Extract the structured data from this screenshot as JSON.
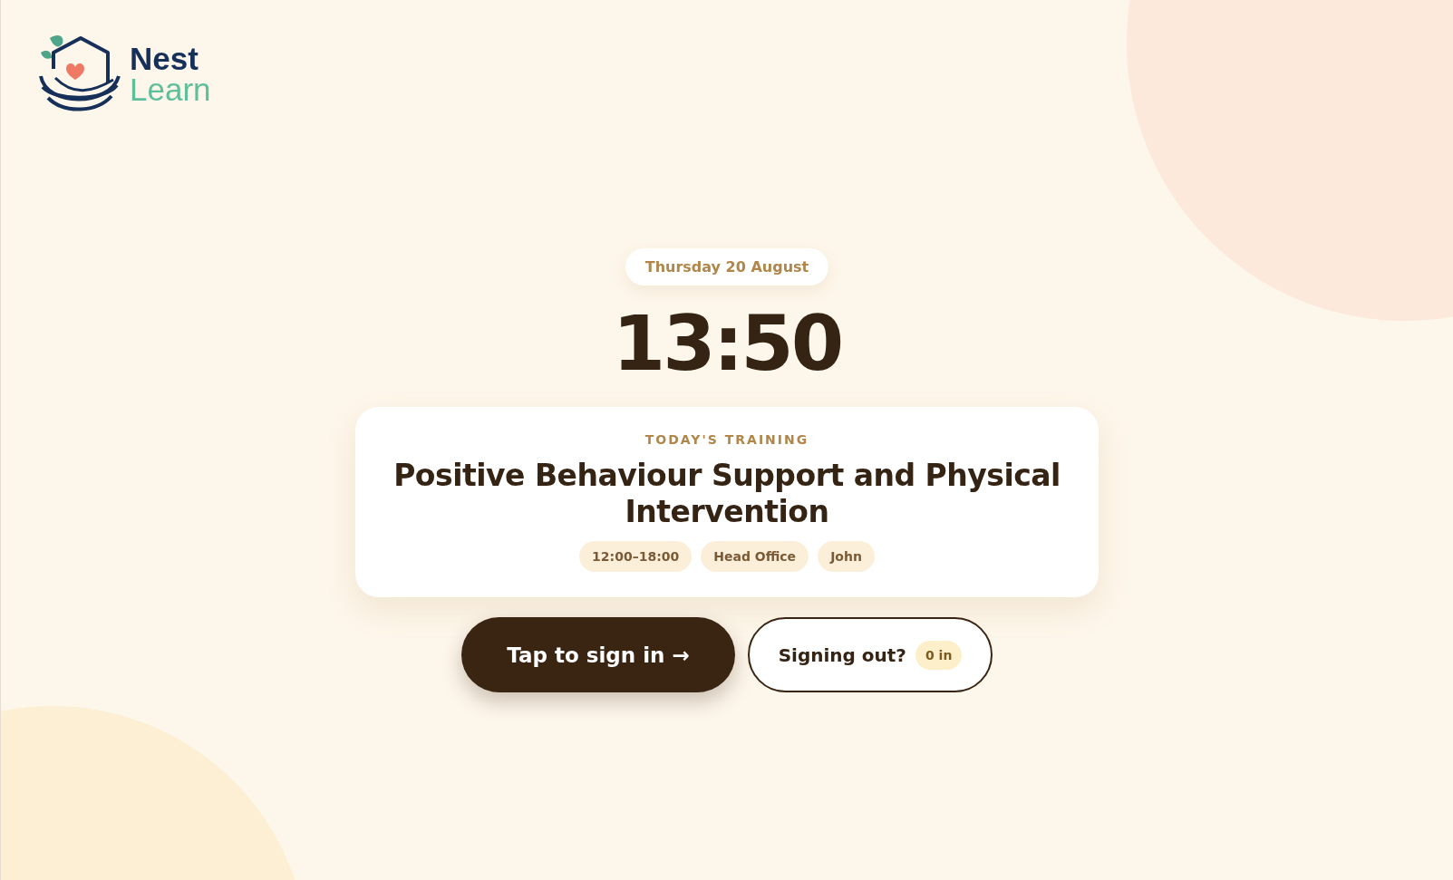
{
  "logo": {
    "line_1": "Nest",
    "line_2": "Learn"
  },
  "date": "Thursday 20 August",
  "clock": "13:50",
  "training": {
    "eyebrow": "TODAY'S TRAINING",
    "title": "Positive Behaviour Support and Physical Intervention",
    "tags": [
      "12:00–18:00",
      "Head Office",
      "John"
    ]
  },
  "sign_in_button": "Tap to sign in →",
  "sign_out_button": {
    "label": "Signing out?",
    "count": "0 in"
  }
}
